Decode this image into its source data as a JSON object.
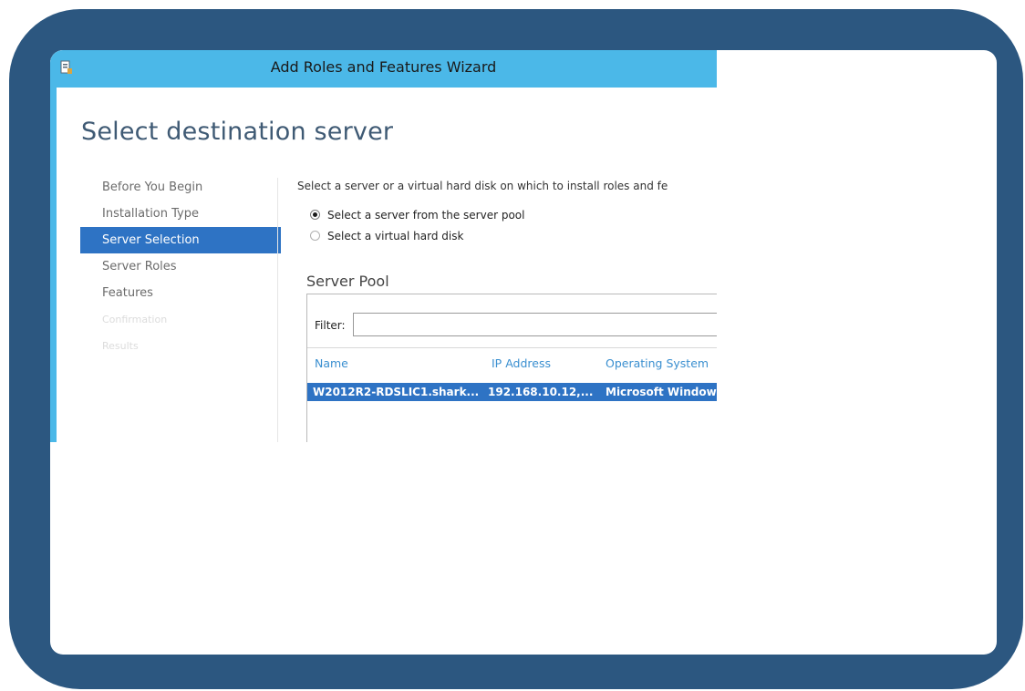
{
  "window": {
    "title": "Add Roles and Features Wizard"
  },
  "page": {
    "title": "Select destination server"
  },
  "nav": {
    "items": [
      {
        "label": "Before You Begin",
        "state": "normal"
      },
      {
        "label": "Installation Type",
        "state": "normal"
      },
      {
        "label": "Server Selection",
        "state": "active"
      },
      {
        "label": "Server Roles",
        "state": "normal"
      },
      {
        "label": "Features",
        "state": "normal"
      },
      {
        "label": "Confirmation",
        "state": "disabled"
      },
      {
        "label": "Results",
        "state": "disabled"
      }
    ]
  },
  "content": {
    "intro": "Select a server or a virtual hard disk on which to install roles and fe",
    "radio_server_pool": "Select a server from the server pool",
    "radio_vhd": "Select a virtual hard disk",
    "pool_title": "Server Pool",
    "filter_label": "Filter:",
    "filter_value": "",
    "columns": [
      "Name",
      "IP Address",
      "Operating System"
    ],
    "rows": [
      {
        "name": "W2012R2-RDSLIC1.shark...",
        "ip": "192.168.10.12,...",
        "os": "Microsoft Window"
      }
    ]
  },
  "colors": {
    "frame": "#2c5780",
    "titlebar": "#4bb8e8",
    "selection": "#2e73c4",
    "heading": "#3f5a74",
    "column_header": "#3a8fd0"
  },
  "icons": {
    "app": "server-manager-icon"
  }
}
